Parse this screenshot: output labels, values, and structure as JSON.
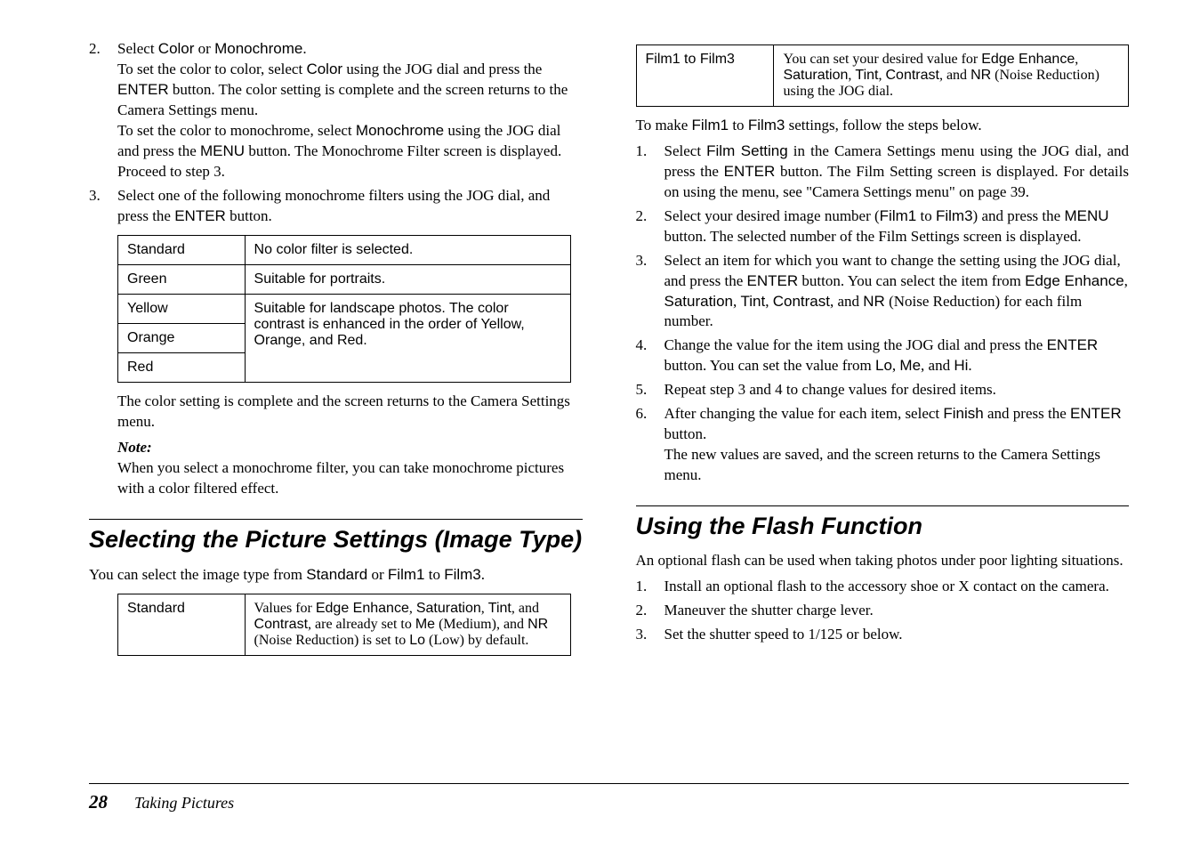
{
  "left": {
    "step2_num": "2.",
    "step2_a": "Select ",
    "step2_b": " or ",
    "step2_c": ".",
    "code_color": "Color",
    "code_mono": "Monochrome",
    "step2_p1_a": "To set the color to color, select ",
    "step2_p1_b": " using the JOG dial and press the ",
    "step2_p1_c": " button. The color setting is complete and the screen returns to the Camera Settings menu.",
    "code_enter": "ENTER",
    "step2_p2_a": "To set the color to monochrome, select ",
    "step2_p2_b": " using the JOG dial and press the ",
    "step2_p2_c": " button. The Monochrome Filter screen is displayed. Proceed to step 3.",
    "code_menu": "MENU",
    "step3_num": "3.",
    "step3_a": "Select one of the following monochrome filters using the JOG dial, and press the ",
    "step3_b": " button.",
    "table1": {
      "r1c1": "Standard",
      "r1c2": "No color filter is selected.",
      "r2c1": "Green",
      "r2c2": "Suitable for portraits.",
      "r3c1": "Yellow",
      "r3c2": "Suitable for landscape photos. The color contrast is enhanced in the order of Yellow, Orange, and Red.",
      "r4c1": "Orange",
      "r5c1": "Red"
    },
    "after_table": "The color setting is complete and the screen returns to the Camera Settings menu.",
    "note_label": "Note:",
    "note_body": "When you select a monochrome filter, you can take monochrome pictures with a color filtered effect.",
    "sec1_title": "Selecting the Picture Settings (Image Type)",
    "sec1_intro_a": "You can select the image type from ",
    "sec1_intro_b": " or ",
    "sec1_intro_c": " to ",
    "sec1_intro_d": ".",
    "code_standard": "Standard",
    "code_film1": "Film1",
    "code_film3": "Film3",
    "table2": {
      "r1c1": "Standard",
      "r1c2_a": "Values for ",
      "r1c2_b": ", ",
      "r1c2_c": ", ",
      "r1c2_d": ", and ",
      "r1c2_e": ", are already set to ",
      "r1c2_f": " (Medium), and ",
      "r1c2_g": " (Noise Reduction) is set to ",
      "r1c2_h": " (Low) by default.",
      "code_edge": "Edge Enhance",
      "code_sat": "Saturation",
      "code_tint": "Tint",
      "code_contrast": "Contrast",
      "code_me": "Me",
      "code_nr": "NR",
      "code_lo": "Lo"
    }
  },
  "right": {
    "table3": {
      "r1c1": "Film1 to Film3",
      "r1c2_a": "You can set your desired value for ",
      "r1c2_b": ", ",
      "r1c2_c": ", ",
      "r1c2_d": ", ",
      "r1c2_e": ", and ",
      "r1c2_f": " (Noise Reduction) using the JOG dial.",
      "code_edge": "Edge Enhance",
      "code_sat": "Saturation",
      "code_tint": "Tint",
      "code_contrast": "Contrast",
      "code_nr": "NR"
    },
    "intro_a": "To make ",
    "intro_b": " to ",
    "intro_c": " settings, follow the steps below.",
    "s1_num": "1.",
    "s1_a": "Select ",
    "s1_b": " in the Camera Settings menu using the JOG dial, and press the ",
    "s1_c": " button. The Film Setting screen is displayed. For details on using the menu, see \"Camera Settings menu\" on page 39.",
    "code_filmsetting": "Film Setting",
    "code_enter": "ENTER",
    "s2_num": "2.",
    "s2_a": "Select your desired image number (",
    "s2_b": " to ",
    "s2_c": ") and press the ",
    "s2_d": " button. The selected number of the Film Settings screen is displayed.",
    "code_menu": "MENU",
    "s3_num": "3.",
    "s3_a": "Select an item for which you want to change the setting using the JOG dial, and press the ",
    "s3_b": " button. You can select the item from ",
    "s3_c": ", ",
    "s3_d": ", ",
    "s3_e": ", ",
    "s3_f": ", and ",
    "s3_g": " (Noise Reduction) for each film number.",
    "code_edge": "Edge Enhance",
    "code_sat": "Saturation",
    "code_tint": "Tint",
    "code_contrast": "Contrast",
    "code_nr": "NR",
    "s4_num": "4.",
    "s4_a": "Change the value for the item using the JOG dial and press the ",
    "s4_b": " button. You can set the value from ",
    "s4_c": ", ",
    "s4_d": ", and ",
    "s4_e": ".",
    "code_lo": "Lo",
    "code_me": "Me",
    "code_hi": "Hi",
    "s5_num": "5.",
    "s5": "Repeat step 3 and 4 to change values for desired items.",
    "s6_num": "6.",
    "s6_a": "After changing the value for each item, select ",
    "s6_b": " and press the ",
    "s6_c": " button.",
    "code_finish": "Finish",
    "s6_d": "The new values are saved, and the screen returns to the Camera Settings menu.",
    "sec2_title": "Using the Flash Function",
    "sec2_intro": "An optional flash can be used when taking photos under poor lighting situations.",
    "f1_num": "1.",
    "f1": "Install an optional flash to the accessory shoe or X contact on the camera.",
    "f2_num": "2.",
    "f2": "Maneuver the shutter charge lever.",
    "f3_num": "3.",
    "f3": "Set the shutter speed to 1/125 or below."
  },
  "footer": {
    "pagenum": "28",
    "title": "Taking Pictures"
  }
}
